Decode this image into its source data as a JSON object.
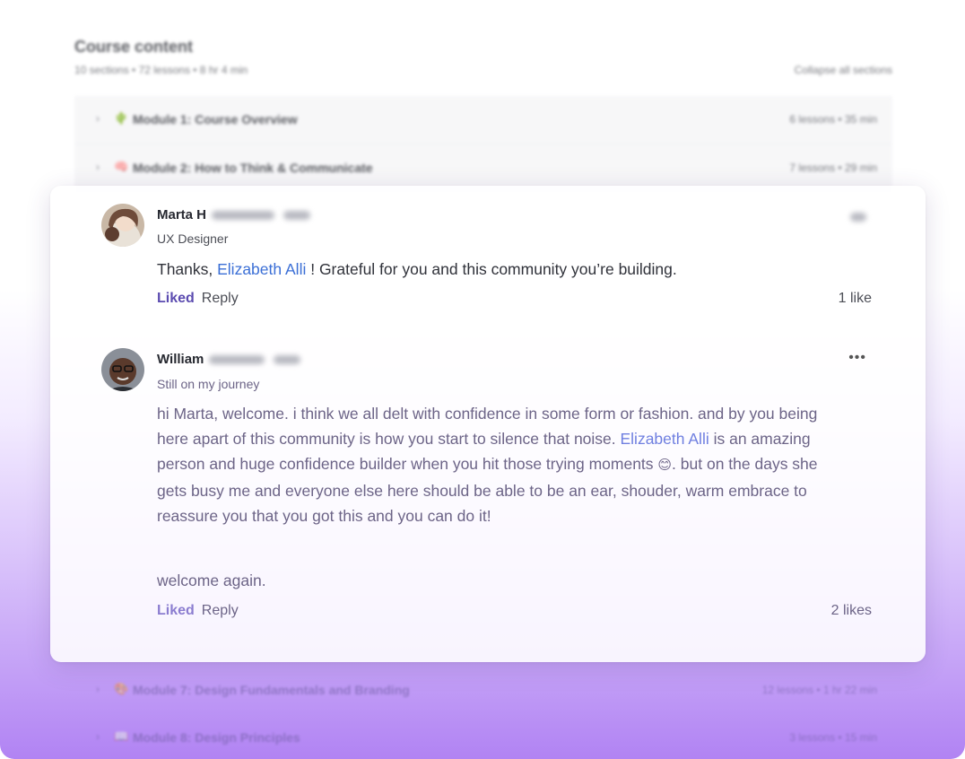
{
  "course": {
    "title": "Course content",
    "meta": "10 sections • 72 lessons • 8 hr 4 min",
    "collapse_label": "Collapse all sections",
    "modules_top": [
      {
        "emoji": "🌵",
        "name": "Module 1: Course Overview",
        "info": "6 lessons • 35 min"
      },
      {
        "emoji": "🧠",
        "name": "Module 2: How to Think & Communicate",
        "info": "7 lessons • 29 min"
      }
    ],
    "modules_bottom": [
      {
        "emoji": "🎨",
        "name": "Module 7: Design Fundamentals and Branding",
        "info": "12 lessons • 1 hr 22 min"
      },
      {
        "emoji": "📖",
        "name": "Module 8: Design Principles",
        "info": "3 lessons • 15 min"
      }
    ]
  },
  "comments": [
    {
      "author": "Marta H",
      "subtitle": "UX Designer",
      "body_before": "Thanks, ",
      "mention": "Elizabeth Alli",
      "body_after": " ! Grateful for you and this community you’re building.",
      "liked_label": "Liked",
      "reply_label": "Reply",
      "likes": "1 like"
    },
    {
      "author": "William",
      "subtitle": "Still on my journey",
      "para1_before": "hi Marta, welcome. i think we all delt with confidence in some form or fashion. and by you being here apart of this community is how you start to silence that noise. ",
      "mention": "Elizabeth Alli",
      "para1_after": " is an  amazing person and huge confidence builder when you hit those trying moments ",
      "emoji": "😊",
      "para1_end": ". but on the days she gets busy me and everyone else here should be able to be an ear, shouder, warm embrace to reassure you that you got this and you can do it!",
      "para2": "welcome again.",
      "liked_label": "Liked",
      "reply_label": "Reply",
      "likes": "2 likes",
      "more_icon": "•••"
    }
  ]
}
